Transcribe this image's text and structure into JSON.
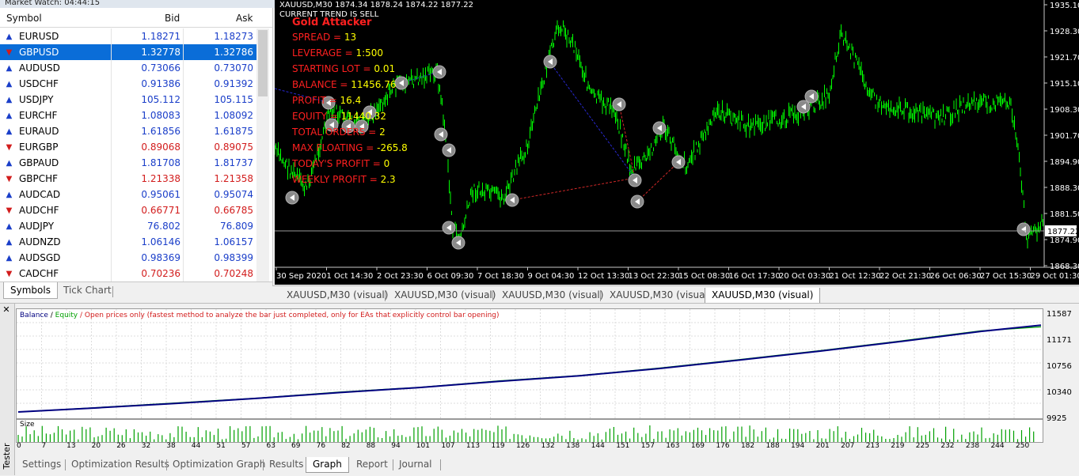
{
  "market_watch": {
    "title": "Market Watch: 04:44:15",
    "columns": {
      "symbol": "Symbol",
      "bid": "Bid",
      "ask": "Ask"
    },
    "rows": [
      {
        "symbol": "EURUSD",
        "bid": "1.18271",
        "ask": "1.18273",
        "dir": "up"
      },
      {
        "symbol": "GBPUSD",
        "bid": "1.32778",
        "ask": "1.32786",
        "dir": "dn",
        "selected": true
      },
      {
        "symbol": "AUDUSD",
        "bid": "0.73066",
        "ask": "0.73070",
        "dir": "up"
      },
      {
        "symbol": "USDCHF",
        "bid": "0.91386",
        "ask": "0.91392",
        "dir": "up"
      },
      {
        "symbol": "USDJPY",
        "bid": "105.112",
        "ask": "105.115",
        "dir": "up"
      },
      {
        "symbol": "EURCHF",
        "bid": "1.08083",
        "ask": "1.08092",
        "dir": "up"
      },
      {
        "symbol": "EURAUD",
        "bid": "1.61856",
        "ask": "1.61875",
        "dir": "up"
      },
      {
        "symbol": "EURGBP",
        "bid": "0.89068",
        "ask": "0.89075",
        "dir": "dn"
      },
      {
        "symbol": "GBPAUD",
        "bid": "1.81708",
        "ask": "1.81737",
        "dir": "up"
      },
      {
        "symbol": "GBPCHF",
        "bid": "1.21338",
        "ask": "1.21358",
        "dir": "dn"
      },
      {
        "symbol": "AUDCAD",
        "bid": "0.95061",
        "ask": "0.95074",
        "dir": "up"
      },
      {
        "symbol": "AUDCHF",
        "bid": "0.66771",
        "ask": "0.66785",
        "dir": "dn"
      },
      {
        "symbol": "AUDJPY",
        "bid": "76.802",
        "ask": "76.809",
        "dir": "up"
      },
      {
        "symbol": "AUDNZD",
        "bid": "1.06146",
        "ask": "1.06157",
        "dir": "up"
      },
      {
        "symbol": "AUDSGD",
        "bid": "0.98369",
        "ask": "0.98399",
        "dir": "up"
      },
      {
        "symbol": "CADCHF",
        "bid": "0.70236",
        "ask": "0.70248",
        "dir": "dn"
      }
    ],
    "tabs": [
      "Symbols",
      "Tick Chart"
    ]
  },
  "chart": {
    "header": "XAUUSD,M30  1874.34 1878.24 1874.22 1877.22",
    "trend": "CURRENT TREND IS SELL",
    "ea_name": "Gold Attacker",
    "info": [
      {
        "label": "SPREAD = ",
        "value": "13"
      },
      {
        "label": "LEVERAGE = ",
        "value": "1:500"
      },
      {
        "label": "STARTING LOT = ",
        "value": "0.01"
      },
      {
        "label": "BALANCE = ",
        "value": "11456.76"
      },
      {
        "label": "PROFIT = ",
        "value": "16.4"
      },
      {
        "label": "EQUITY = ",
        "value": "11440.32"
      },
      {
        "label": "TOTAL ORDERS = ",
        "value": "2"
      },
      {
        "label": "MAX FLOATING = ",
        "value": "-265.8"
      },
      {
        "label": "TODAY'S PROFIT = ",
        "value": "0"
      },
      {
        "label": "WEEKLY PROFIT = ",
        "value": "2.3"
      }
    ],
    "y_ticks": [
      "1935.10",
      "1928.30",
      "1921.70",
      "1915.10",
      "1908.30",
      "1901.70",
      "1894.90",
      "1888.30",
      "1881.50",
      "1874.90",
      "1868.30"
    ],
    "current_price": "1877.22",
    "x_ticks": [
      "30 Sep 2020",
      "1 Oct 14:30",
      "2 Oct 23:30",
      "6 Oct 09:30",
      "7 Oct 18:30",
      "9 Oct 04:30",
      "12 Oct 13:30",
      "13 Oct 22:30",
      "15 Oct 08:30",
      "16 Oct 17:30",
      "20 Oct 03:30",
      "21 Oct 12:30",
      "22 Oct 21:30",
      "26 Oct 06:30",
      "27 Oct 15:30",
      "29 Oct 01:30"
    ],
    "tabs": [
      "XAUUSD,M30 (visual)",
      "XAUUSD,M30 (visual)",
      "XAUUSD,M30 (visual)",
      "XAUUSD,M30 (visual)",
      "XAUUSD,M30 (visual)"
    ],
    "colors": {
      "bars": "#00ff00",
      "balance": "#000080",
      "equity": "#00a000"
    }
  },
  "tester": {
    "side_label": "Tester",
    "legend": {
      "balance": "Balance",
      "sep": " / ",
      "equity": "Equity",
      "rest": " / Open prices only (fastest method to analyze the bar just completed, only for EAs that explicitly control bar opening)"
    },
    "y_ticks": [
      "11587",
      "11171",
      "10756",
      "10340",
      "9925"
    ],
    "size_label": "Size",
    "x_ticks": [
      "0",
      "7",
      "13",
      "20",
      "26",
      "32",
      "38",
      "44",
      "51",
      "57",
      "63",
      "69",
      "76",
      "82",
      "88",
      "94",
      "101",
      "107",
      "113",
      "119",
      "126",
      "132",
      "138",
      "144",
      "151",
      "157",
      "163",
      "169",
      "176",
      "182",
      "188",
      "194",
      "201",
      "207",
      "213",
      "219",
      "225",
      "232",
      "238",
      "244",
      "250"
    ],
    "tabs": [
      "Settings",
      "Optimization Results",
      "Optimization Graph",
      "Results",
      "Graph",
      "Report",
      "Journal"
    ],
    "active_tab": "Graph"
  },
  "chart_data": {
    "type": "line",
    "title": "",
    "xlabel": "",
    "ylabel": "",
    "ylim": [
      9925,
      11587
    ],
    "series": [
      {
        "name": "Balance",
        "x": [
          0,
          20,
          40,
          60,
          80,
          100,
          120,
          140,
          160,
          180,
          200,
          220,
          240,
          255
        ],
        "values": [
          9925,
          10000,
          10080,
          10170,
          10270,
          10360,
          10470,
          10570,
          10700,
          10850,
          11010,
          11180,
          11360,
          11470
        ]
      },
      {
        "name": "Equity",
        "x": [
          0,
          20,
          40,
          60,
          80,
          100,
          120,
          140,
          160,
          180,
          200,
          220,
          240,
          255
        ],
        "values": [
          9925,
          10005,
          10090,
          10175,
          10280,
          10365,
          10480,
          10575,
          10710,
          10860,
          11020,
          11190,
          11370,
          11440
        ]
      }
    ]
  }
}
